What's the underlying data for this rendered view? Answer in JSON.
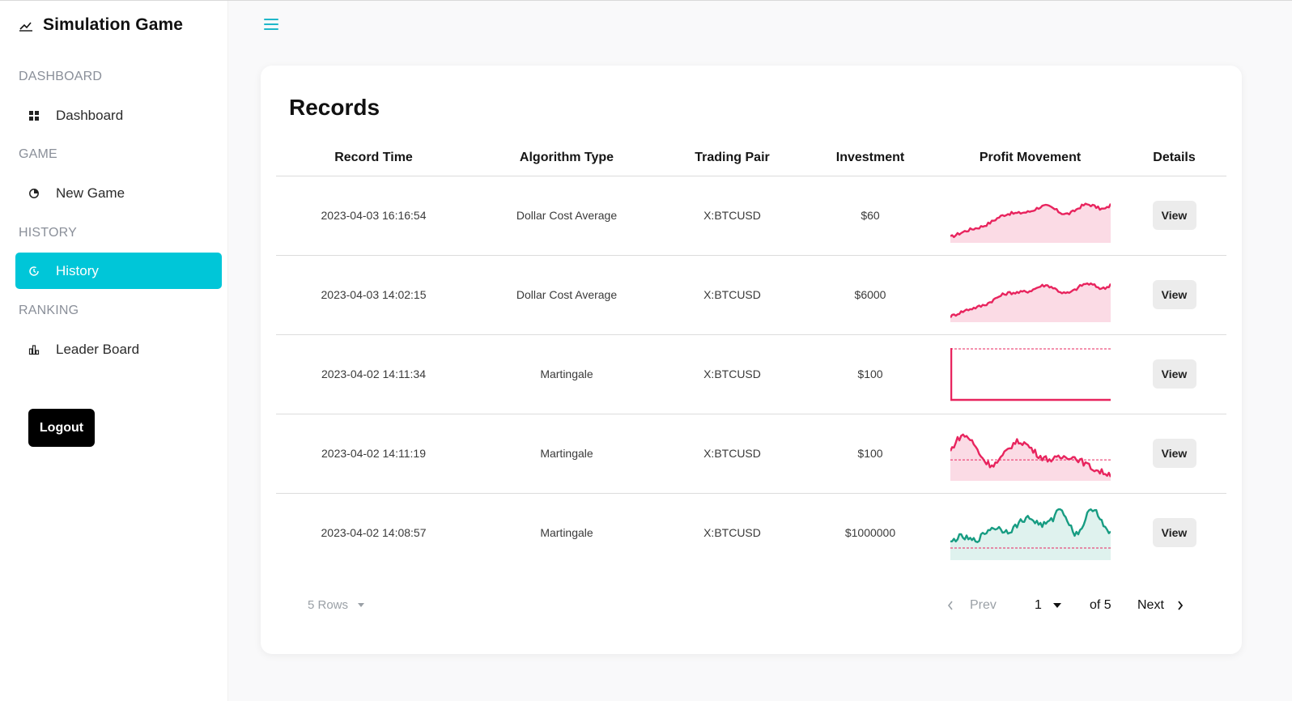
{
  "app": {
    "title": "Simulation Game",
    "logo_icon": "chart-line-icon"
  },
  "sidebar": {
    "sections": [
      {
        "label": "DASHBOARD",
        "items": [
          {
            "label": "Dashboard",
            "icon": "grid-icon",
            "active": false
          }
        ]
      },
      {
        "label": "GAME",
        "items": [
          {
            "label": "New Game",
            "icon": "pie-chart-icon",
            "active": false
          }
        ]
      },
      {
        "label": "HISTORY",
        "items": [
          {
            "label": "History",
            "icon": "history-icon",
            "active": true
          }
        ]
      },
      {
        "label": "RANKING",
        "items": [
          {
            "label": "Leader Board",
            "icon": "bar-chart-icon",
            "active": false
          }
        ]
      }
    ],
    "logout_label": "Logout"
  },
  "header": {
    "menu_icon": "hamburger-icon"
  },
  "records": {
    "title": "Records",
    "columns": [
      "Record Time",
      "Algorithm Type",
      "Trading Pair",
      "Investment",
      "Profit Movement",
      "Details"
    ],
    "rows": [
      {
        "time": "2023-04-03 16:16:54",
        "algorithm": "Dollar Cost Average",
        "pair": "X:BTCUSD",
        "investment": "$60",
        "trend": "up",
        "view_label": "View"
      },
      {
        "time": "2023-04-03 14:02:15",
        "algorithm": "Dollar Cost Average",
        "pair": "X:BTCUSD",
        "investment": "$6000",
        "trend": "up",
        "view_label": "View"
      },
      {
        "time": "2023-04-02 14:11:34",
        "algorithm": "Martingale",
        "pair": "X:BTCUSD",
        "investment": "$100",
        "trend": "flat",
        "view_label": "View"
      },
      {
        "time": "2023-04-02 14:11:19",
        "algorithm": "Martingale",
        "pair": "X:BTCUSD",
        "investment": "$100",
        "trend": "down",
        "view_label": "View"
      },
      {
        "time": "2023-04-02 14:08:57",
        "algorithm": "Martingale",
        "pair": "X:BTCUSD",
        "investment": "$1000000",
        "trend": "up-volatile",
        "view_label": "View"
      }
    ]
  },
  "pagination": {
    "rows_label": "5 Rows",
    "prev_label": "Prev",
    "current_page": "1",
    "of_total": "of 5",
    "next_label": "Next"
  },
  "colors": {
    "accent": "#00c6d8",
    "loss": "#e8245e",
    "loss_fill": "#fbdbe5",
    "gain": "#179c82",
    "gain_fill": "#dff2ee"
  }
}
